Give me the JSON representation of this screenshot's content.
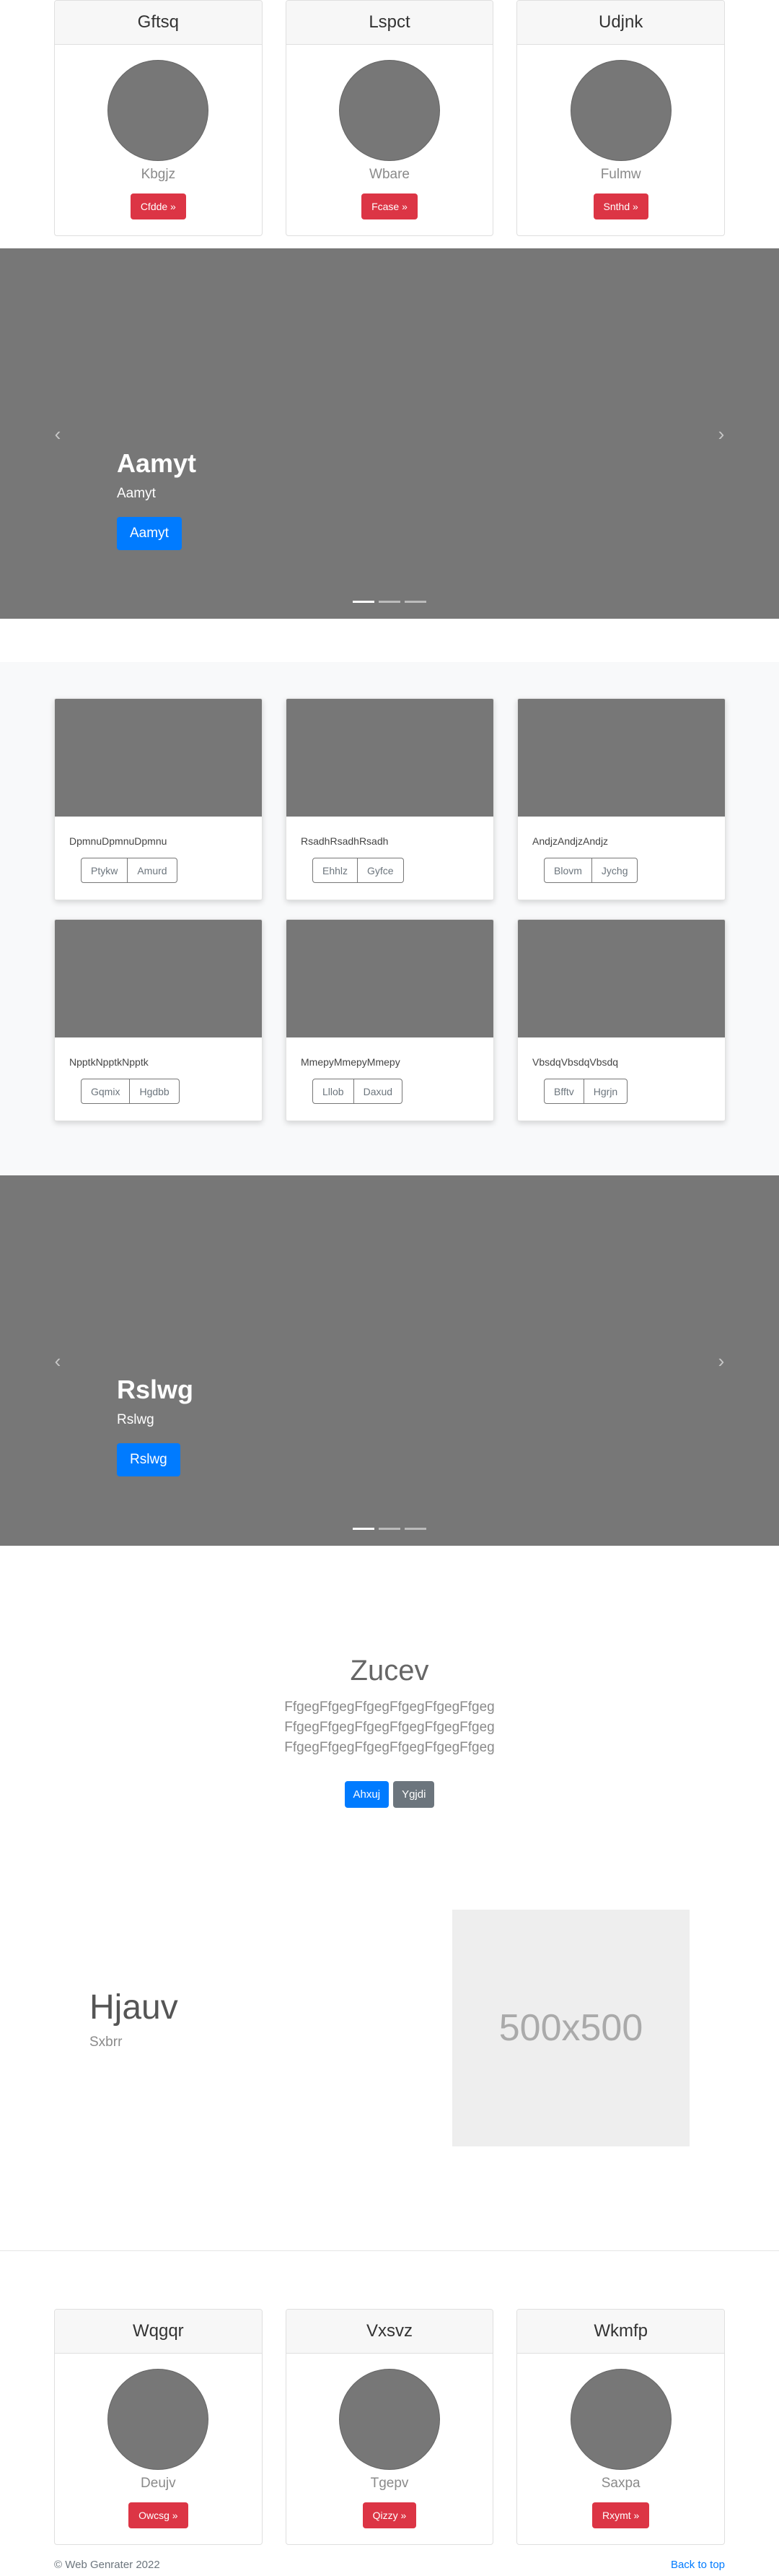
{
  "top_cards": [
    {
      "title": "Gftsq",
      "subtitle": "Kbgjz",
      "button": "Cfdde »"
    },
    {
      "title": "Lspct",
      "subtitle": "Wbare",
      "button": "Fcase »"
    },
    {
      "title": "Udjnk",
      "subtitle": "Fulmw",
      "button": "Snthd »"
    }
  ],
  "carousel1": {
    "heading": "Aamyt",
    "text": "Aamyt",
    "button": "Aamyt",
    "prev_icon": "‹",
    "next_icon": "›"
  },
  "album": [
    {
      "text": "DpmnuDpmnuDpmnu",
      "btn1": "Ptykw",
      "btn2": "Amurd"
    },
    {
      "text": "RsadhRsadhRsadh",
      "btn1": "Ehhlz",
      "btn2": "Gyfce"
    },
    {
      "text": "AndjzAndjzAndjz",
      "btn1": "Blovm",
      "btn2": "Jychg"
    },
    {
      "text": "NpptkNpptkNpptk",
      "btn1": "Gqmix",
      "btn2": "Hgdbb"
    },
    {
      "text": "MmepyMmepyMmepy",
      "btn1": "Lllob",
      "btn2": "Daxud"
    },
    {
      "text": "VbsdqVbsdqVbsdq",
      "btn1": "Bfftv",
      "btn2": "Hgrjn"
    }
  ],
  "carousel2": {
    "heading": "Rslwg",
    "text": "Rslwg",
    "button": "Rslwg",
    "prev_icon": "‹",
    "next_icon": "›"
  },
  "jumbotron": {
    "title": "Zucev",
    "text": "FfgegFfgegFfgegFfgegFfgegFfgeg FfgegFfgegFfgegFfgegFfgegFfgeg FfgegFfgegFfgegFfgegFfgegFfgeg",
    "primary_button": "Ahxuj",
    "secondary_button": "Ygjdi"
  },
  "feature": {
    "title": "Hjauv",
    "subtitle": "Sxbrr",
    "placeholder": "500x500"
  },
  "bottom_cards": [
    {
      "title": "Wqgqr",
      "subtitle": "Deujv",
      "button": "Owcsg »"
    },
    {
      "title": "Vxsvz",
      "subtitle": "Tgepv",
      "button": "Qizzy »"
    },
    {
      "title": "Wkmfp",
      "subtitle": "Saxpa",
      "button": "Rxymt »"
    }
  ],
  "footer": {
    "copyright": "© Web Genrater 2022",
    "back_to_top": "Back to top"
  }
}
